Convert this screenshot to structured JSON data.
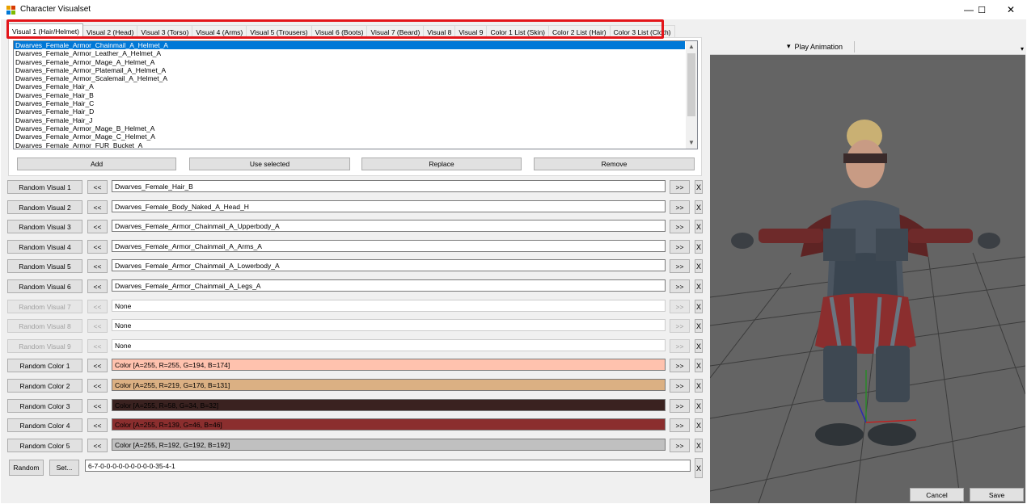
{
  "window": {
    "title": "Character Visualset",
    "minimize_glyph": "—",
    "maximize_glyph": "☐",
    "close_glyph": "✕"
  },
  "tabs": [
    {
      "label": "Visual 1 (Hair/Helmet)",
      "active": true
    },
    {
      "label": "Visual 2 (Head)"
    },
    {
      "label": "Visual 3 (Torso)"
    },
    {
      "label": "Visual 4 (Arms)"
    },
    {
      "label": "Visual 5 (Trousers)"
    },
    {
      "label": "Visual 6 (Boots)"
    },
    {
      "label": "Visual 7 (Beard)"
    },
    {
      "label": "Visual 8"
    },
    {
      "label": "Visual 9"
    },
    {
      "label": "Color 1 List (Skin)"
    },
    {
      "label": "Color 2 List (Hair)"
    },
    {
      "label": "Color 3 List (Cloth)"
    }
  ],
  "list": {
    "items": [
      "Dwarves_Female_Armor_Chainmail_A_Helmet_A",
      "Dwarves_Female_Armor_Leather_A_Helmet_A",
      "Dwarves_Female_Armor_Mage_A_Helmet_A",
      "Dwarves_Female_Armor_Platemail_A_Helmet_A",
      "Dwarves_Female_Armor_Scalemail_A_Helmet_A",
      "Dwarves_Female_Hair_A",
      "Dwarves_Female_Hair_B",
      "Dwarves_Female_Hair_C",
      "Dwarves_Female_Hair_D",
      "Dwarves_Female_Hair_J",
      "Dwarves_Female_Armor_Mage_B_Helmet_A",
      "Dwarves_Female_Armor_Mage_C_Helmet_A",
      "Dwarves_Female_Armor_FUR_Bucket_A"
    ],
    "selected_index": 0
  },
  "list_buttons": {
    "add": "Add",
    "use_selected": "Use selected",
    "replace": "Replace",
    "remove": "Remove"
  },
  "rows": [
    {
      "button": "Random Visual 1",
      "value": "Dwarves_Female_Hair_B",
      "enabled": true
    },
    {
      "button": "Random Visual 2",
      "value": "Dwarves_Female_Body_Naked_A_Head_H",
      "enabled": true
    },
    {
      "button": "Random Visual 3",
      "value": "Dwarves_Female_Armor_Chainmail_A_Upperbody_A",
      "enabled": true
    },
    {
      "button": "Random Visual 4",
      "value": "Dwarves_Female_Armor_Chainmail_A_Arms_A",
      "enabled": true
    },
    {
      "button": "Random Visual 5",
      "value": "Dwarves_Female_Armor_Chainmail_A_Lowerbody_A",
      "enabled": true
    },
    {
      "button": "Random Visual 6",
      "value": "Dwarves_Female_Armor_Chainmail_A_Legs_A",
      "enabled": true
    },
    {
      "button": "Random Visual 7",
      "value": "None",
      "enabled": false
    },
    {
      "button": "Random Visual 8",
      "value": "None",
      "enabled": false
    },
    {
      "button": "Random Visual 9",
      "value": "None",
      "enabled": false
    },
    {
      "button": "Random Color 1",
      "value": "Color [A=255, R=255, G=194, B=174]",
      "enabled": true,
      "bg": "#ffc2ae",
      "fg": "#000000"
    },
    {
      "button": "Random Color 2",
      "value": "Color [A=255, R=219, G=176, B=131]",
      "enabled": true,
      "bg": "#dbb083",
      "fg": "#000000"
    },
    {
      "button": "Random Color 3",
      "value": "Color [A=255, R=58, G=34, B=32]",
      "enabled": true,
      "bg": "#3a2220",
      "fg": "#000000"
    },
    {
      "button": "Random Color 4",
      "value": "Color [A=255, R=139, G=46, B=46]",
      "enabled": true,
      "bg": "#8b2e2e",
      "fg": "#000000"
    },
    {
      "button": "Random Color 5",
      "value": "Color [A=255, R=192, G=192, B=192]",
      "enabled": true,
      "bg": "#c0c0c0",
      "fg": "#000000"
    }
  ],
  "nav": {
    "prev": "<<",
    "next": ">>",
    "clear": "X"
  },
  "bottom": {
    "random_label": "Random",
    "set_label": "Set...",
    "code_value": "6-7-0-0-0-0-0-0-0-0-0-35-4-1",
    "clear": "X"
  },
  "viewport": {
    "play_animation_label": "Play Animation",
    "dropdown_glyph": "▾",
    "corner_glyph": "▾"
  },
  "footer": {
    "cancel": "Cancel",
    "save": "Save"
  },
  "colors": {
    "selection": "#0078d7",
    "highlight_border": "#e3151a",
    "viewport_bg": "#646464"
  }
}
